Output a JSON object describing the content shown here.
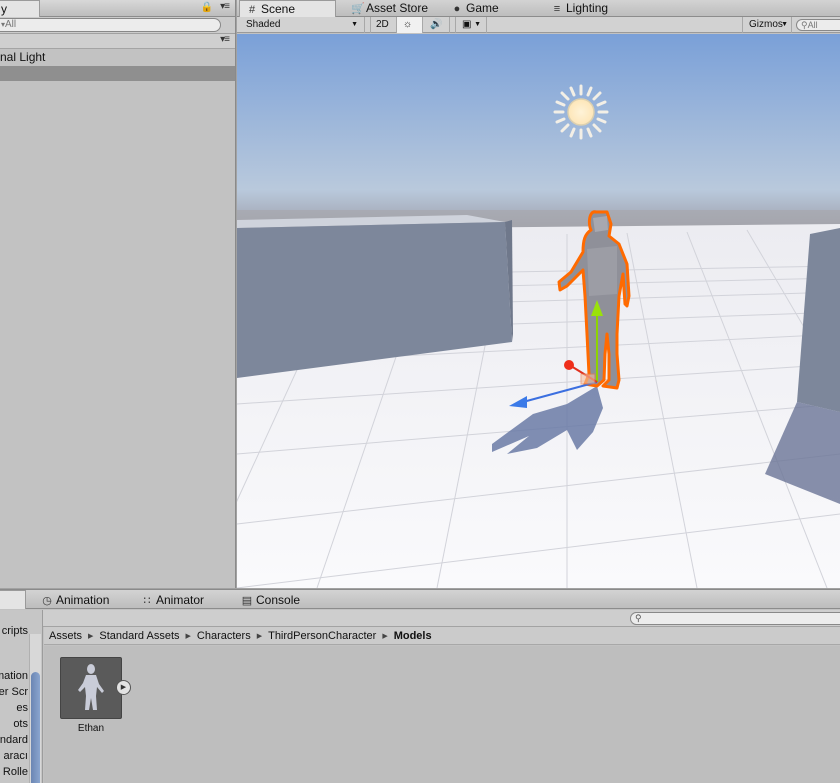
{
  "hierarchy": {
    "tab_label": "y",
    "search_placeholder": "All",
    "items": [
      "nal Light",
      ""
    ]
  },
  "scene": {
    "tabs": [
      {
        "label": "Scene",
        "icon": "grid-icon"
      },
      {
        "label": "Asset Store",
        "icon": "store-icon"
      },
      {
        "label": "Game",
        "icon": "game-icon"
      },
      {
        "label": "Lighting",
        "icon": "lighting-icon"
      }
    ],
    "toolbar": {
      "draw_mode": "Shaded",
      "mode_2d": "2D",
      "gizmos": "Gizmos",
      "search_placeholder": "All"
    }
  },
  "bottom": {
    "tabs": [
      {
        "label": "Animation",
        "icon": "clock-icon"
      },
      {
        "label": "Animator",
        "icon": "animator-icon"
      },
      {
        "label": "Console",
        "icon": "console-icon"
      }
    ],
    "tree_items": [
      "cripts",
      "mation",
      "er Scr",
      "es",
      "ots",
      "ndard",
      "aracı",
      "Rolle"
    ],
    "breadcrumb": [
      "Assets",
      "Standard Assets",
      "Characters",
      "ThirdPersonCharacter",
      "Models"
    ],
    "search_placeholder": "",
    "assets": [
      {
        "name": "Ethan"
      }
    ]
  },
  "colors": {
    "selection_outline": "#ff6a00",
    "sky_top": "#7aa0d8",
    "panel_bg": "#c2c2c2",
    "scrollbar": "#7b94c0"
  }
}
